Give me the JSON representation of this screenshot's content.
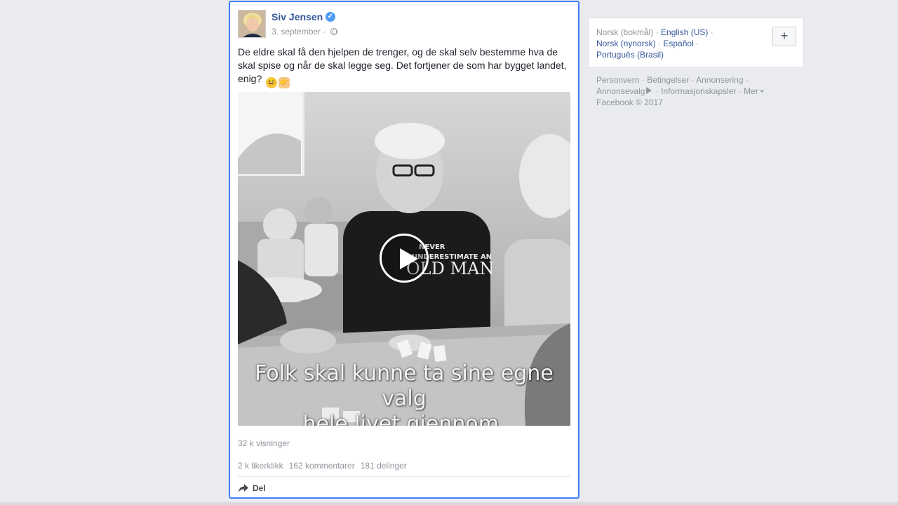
{
  "post": {
    "author": "Siv Jensen",
    "date": "3. september",
    "meta_separator": "·",
    "text": "De eldre skal få den hjelpen de trenger, og de skal selv bestemme hva de skal spise og når de skal legge seg. Det fortjener de som har bygget landet, enig?",
    "emoji_1": "😆",
    "emoji_2": "👉",
    "video": {
      "caption_line_1": "Folk skal kunne ta sine egne valg",
      "caption_line_2": "hele livet gjennom.",
      "shirt_text_1": "NEVER",
      "shirt_text_2": "UNDERESTIMATE AN",
      "shirt_text_3": "OLD MAN"
    },
    "views": "32 k visninger",
    "likes": "2 k likerklikk",
    "comments": "162 kommentarer",
    "shares": "181 delinger",
    "share_label": "Del"
  },
  "sidebar": {
    "languages": {
      "current": "Norsk (bokmål)",
      "lang_1": "English (US)",
      "lang_2": "Norsk (nynorsk)",
      "lang_3": "Español",
      "lang_4": "Português (Brasil)",
      "separator": "·",
      "add_label": "+"
    },
    "footer": {
      "privacy": "Personvern",
      "terms": "Betingelser",
      "advertising": "Annonsering",
      "ad_choices": "Annonsevalg",
      "cookies": "Informasjonskapsler",
      "more": "Mer",
      "copyright": "Facebook © 2017",
      "separator": "·"
    }
  },
  "colors": {
    "link": "#365899",
    "muted": "#90949c",
    "highlight_border": "#4080ff",
    "background": "#e9ebee"
  }
}
